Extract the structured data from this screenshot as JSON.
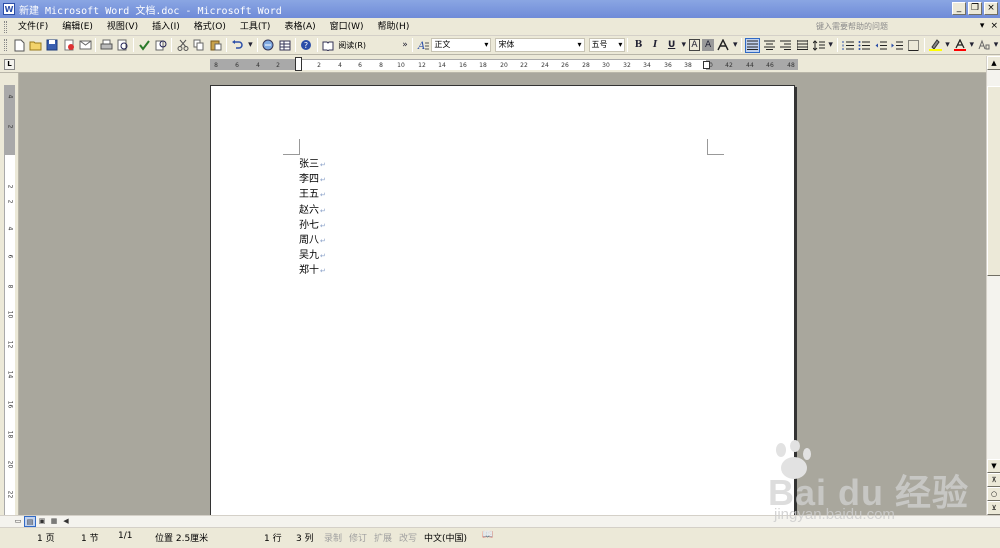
{
  "window": {
    "title": "新建 Microsoft Word 文档.doc - Microsoft Word",
    "app_icon": "W",
    "minimize": "_",
    "restore": "❐",
    "close": "×"
  },
  "menu": {
    "items": [
      "文件(F)",
      "编辑(E)",
      "视图(V)",
      "插入(I)",
      "格式(O)",
      "工具(T)",
      "表格(A)",
      "窗口(W)",
      "帮助(H)"
    ],
    "help_placeholder": "键入需要帮助的问题",
    "dropdown": "▾",
    "close_doc": "×"
  },
  "toolbar": {
    "reading_label": "阅读(R)",
    "style_value": "正文",
    "font_value": "宋体",
    "size_value": "五号",
    "bold": "B",
    "italic": "I",
    "underline": "U",
    "style_icon_glyph": "A"
  },
  "ruler": {
    "corner_glyph": "L",
    "h_ticks": [
      "8",
      "6",
      "4",
      "2",
      "2",
      "4",
      "6",
      "8",
      "10",
      "12",
      "14",
      "16",
      "18",
      "20",
      "22",
      "24",
      "26",
      "28",
      "30",
      "32",
      "34",
      "36",
      "38",
      "40",
      "42",
      "44",
      "46",
      "48"
    ],
    "v_ticks": [
      "4",
      "2",
      "2",
      "2",
      "4",
      "6",
      "8",
      "10",
      "12",
      "14",
      "16",
      "18",
      "20",
      "22"
    ]
  },
  "document": {
    "lines": [
      "张三",
      "李四",
      "王五",
      "赵六",
      "孙七",
      "周八",
      "吴九",
      "郑十"
    ],
    "paragraph_mark": "↵"
  },
  "scrollbar": {
    "up": "▲",
    "down": "▼",
    "prev_page": "⊼",
    "select_browse": "○",
    "next_page": "⊻",
    "left": "◀"
  },
  "view_buttons": [
    "▭",
    "▤",
    "▣",
    "▦"
  ],
  "status": {
    "page": "1 页",
    "section": "1 节",
    "page_of": "1/1",
    "position": "位置 2.5厘米",
    "line": "1 行",
    "column": "3 列",
    "record": "录制",
    "revise": "修订",
    "extend": "扩展",
    "overtype": "改写",
    "language": "中文(中国)",
    "book_icon": "📖"
  },
  "watermark": {
    "brand": "Bai du 经验",
    "url": "jingyan.baidu.com"
  }
}
